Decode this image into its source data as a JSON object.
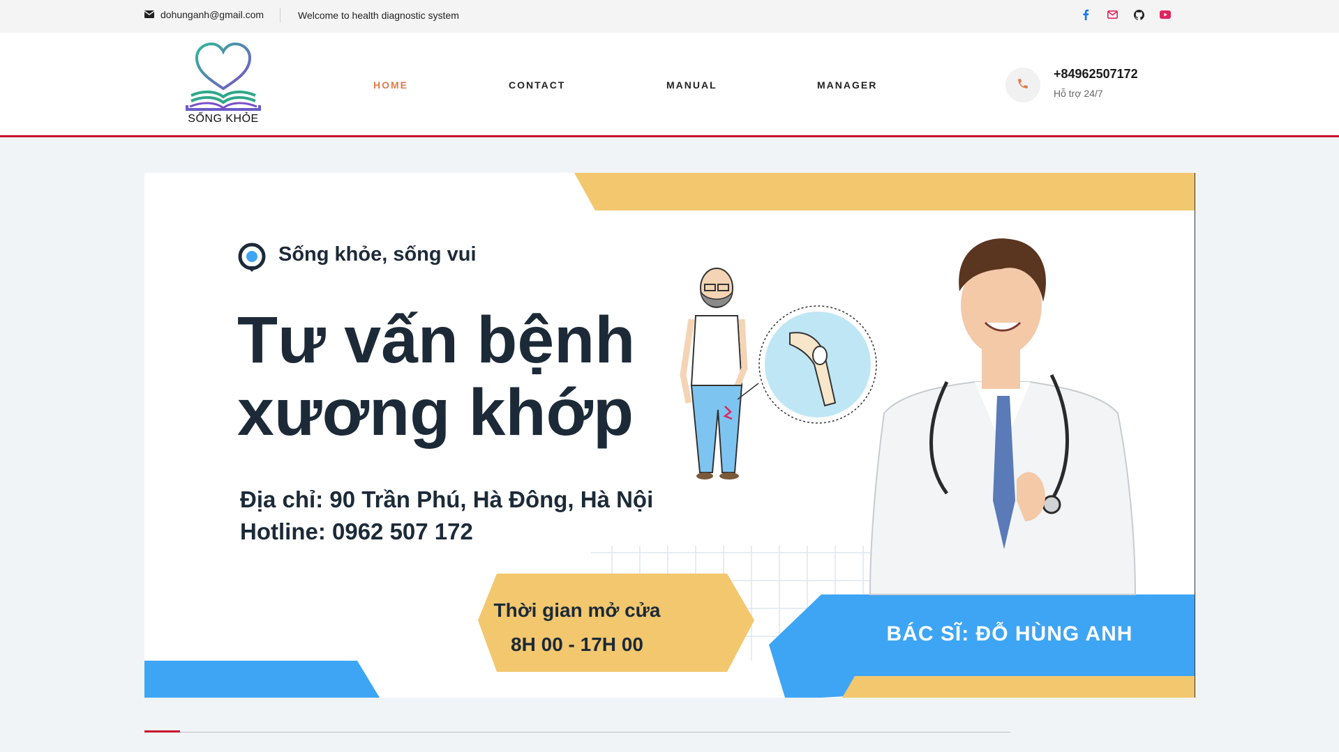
{
  "topbar": {
    "email": "dohunganh@gmail.com",
    "welcome": "Welcome to health diagnostic system",
    "social": [
      {
        "icon": "facebook-icon",
        "color": "#1877f2"
      },
      {
        "icon": "mail-icon",
        "color": "#e0245e"
      },
      {
        "icon": "github-icon",
        "color": "#222222"
      },
      {
        "icon": "youtube-icon",
        "color": "#e0245e"
      }
    ]
  },
  "header": {
    "logo_text": "SỐNG KHỎE",
    "nav": [
      {
        "label": "HOME",
        "active": true
      },
      {
        "label": "CONTACT",
        "active": false
      },
      {
        "label": "MANUAL",
        "active": false
      },
      {
        "label": "MANAGER",
        "active": false
      }
    ],
    "phone": "+84962507172",
    "support": "Hỗ trợ 24/7"
  },
  "banner": {
    "tagline": "Sống khỏe, sống vui",
    "title_line1": "Tư vấn bệnh",
    "title_line2": "xương khớp",
    "address": "Địa chỉ: 90 Trần Phú, Hà Đông, Hà Nội",
    "hotline": "Hotline: 0962 507 172",
    "hours_title": "Thời gian mở cửa",
    "hours_value": "8H 00 - 17H 00",
    "doctor": "BÁC SĨ: ĐỖ HÙNG ANH"
  },
  "colors": {
    "accent": "#e07a4a",
    "brand_red": "#c8102e",
    "banner_yellow": "#f2c76e",
    "banner_blue": "#3ea5f5",
    "text_dark": "#1c2a38"
  }
}
